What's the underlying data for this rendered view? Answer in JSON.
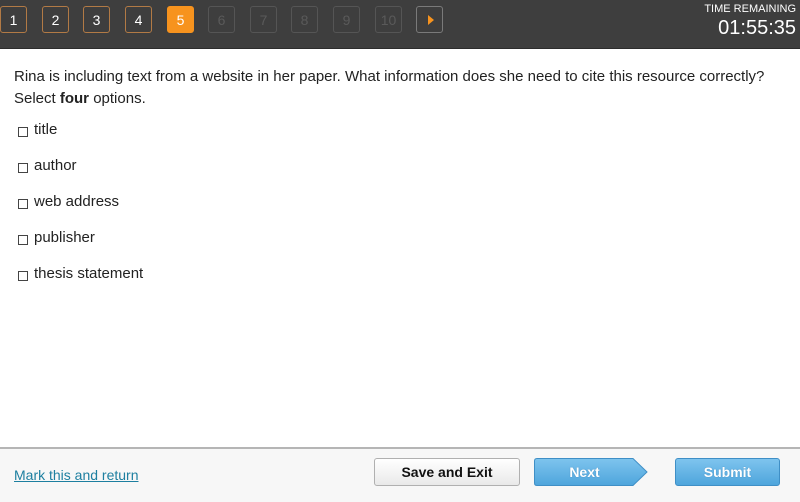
{
  "nav": {
    "questions": [
      {
        "label": "1",
        "state": "done"
      },
      {
        "label": "2",
        "state": "done"
      },
      {
        "label": "3",
        "state": "done"
      },
      {
        "label": "4",
        "state": "done"
      },
      {
        "label": "5",
        "state": "current"
      },
      {
        "label": "6",
        "state": "locked"
      },
      {
        "label": "7",
        "state": "locked"
      },
      {
        "label": "8",
        "state": "locked"
      },
      {
        "label": "9",
        "state": "locked"
      },
      {
        "label": "10",
        "state": "locked"
      }
    ],
    "next_arrow_icon": "play-arrow-icon"
  },
  "timer": {
    "label": "TIME REMAINING",
    "value": "01:55:35"
  },
  "question": {
    "text": "Rina is including text from a website in her paper. What information does she need to cite this resource correctly?",
    "instruction_prefix": "Select ",
    "instruction_bold": "four",
    "instruction_suffix": " options."
  },
  "options": [
    {
      "label": "title",
      "checked": false
    },
    {
      "label": "author",
      "checked": false
    },
    {
      "label": "web address",
      "checked": false
    },
    {
      "label": "publisher",
      "checked": false
    },
    {
      "label": "thesis statement",
      "checked": false
    }
  ],
  "footer": {
    "mark_link": "Mark this and return",
    "save_label": "Save and Exit",
    "next_label": "Next",
    "submit_label": "Submit"
  },
  "colors": {
    "accent_orange": "#f7931e",
    "topbar": "#3e3e3e",
    "button_blue": "#5aaee2",
    "link": "#1d7fa0"
  }
}
